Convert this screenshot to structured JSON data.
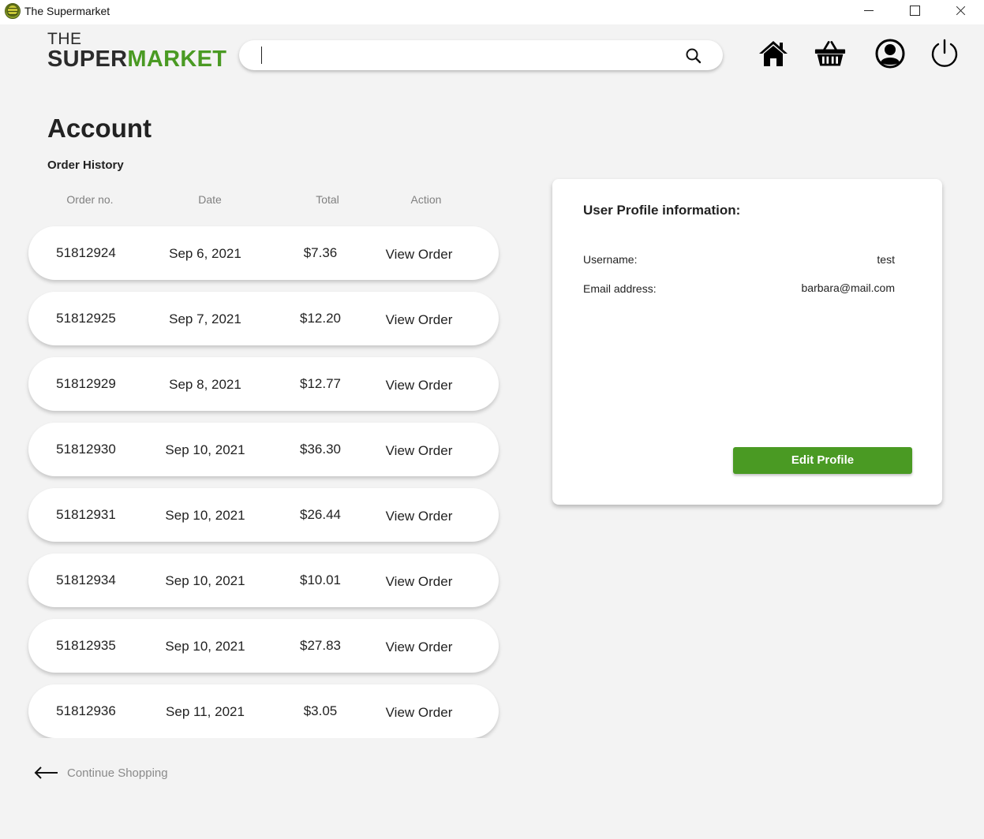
{
  "window": {
    "title": "The Supermarket"
  },
  "header": {
    "logo_the": "THE",
    "logo_super": "SUPER",
    "logo_market": "MARKET",
    "search_value": "",
    "nav": [
      "home-icon",
      "basket-icon",
      "account-icon",
      "power-icon"
    ]
  },
  "colors": {
    "brand_green": "#4a9a23",
    "background": "#f3f3f3",
    "card": "#ffffff"
  },
  "main": {
    "title": "Account",
    "order_history_title": "Order History",
    "columns": [
      "Order no.",
      "Date",
      "Total",
      "Action"
    ],
    "orders": [
      {
        "order_no": "51812924",
        "date": "Sep 6, 2021",
        "total": "$7.36",
        "action": "View Order"
      },
      {
        "order_no": "51812925",
        "date": "Sep 7, 2021",
        "total": "$12.20",
        "action": "View Order"
      },
      {
        "order_no": "51812929",
        "date": "Sep 8, 2021",
        "total": "$12.77",
        "action": "View Order"
      },
      {
        "order_no": "51812930",
        "date": "Sep 10, 2021",
        "total": "$36.30",
        "action": "View Order"
      },
      {
        "order_no": "51812931",
        "date": "Sep 10, 2021",
        "total": "$26.44",
        "action": "View Order"
      },
      {
        "order_no": "51812934",
        "date": "Sep 10, 2021",
        "total": "$10.01",
        "action": "View Order"
      },
      {
        "order_no": "51812935",
        "date": "Sep 10, 2021",
        "total": "$27.83",
        "action": "View Order"
      },
      {
        "order_no": "51812936",
        "date": "Sep 11, 2021",
        "total": "$3.05",
        "action": "View Order"
      }
    ],
    "continue_label": "Continue Shopping"
  },
  "profile": {
    "title": "User Profile information:",
    "username_label": "Username:",
    "username_value": "test",
    "email_label": "Email address:",
    "email_value": "barbara@mail.com",
    "edit_button": "Edit Profile"
  }
}
